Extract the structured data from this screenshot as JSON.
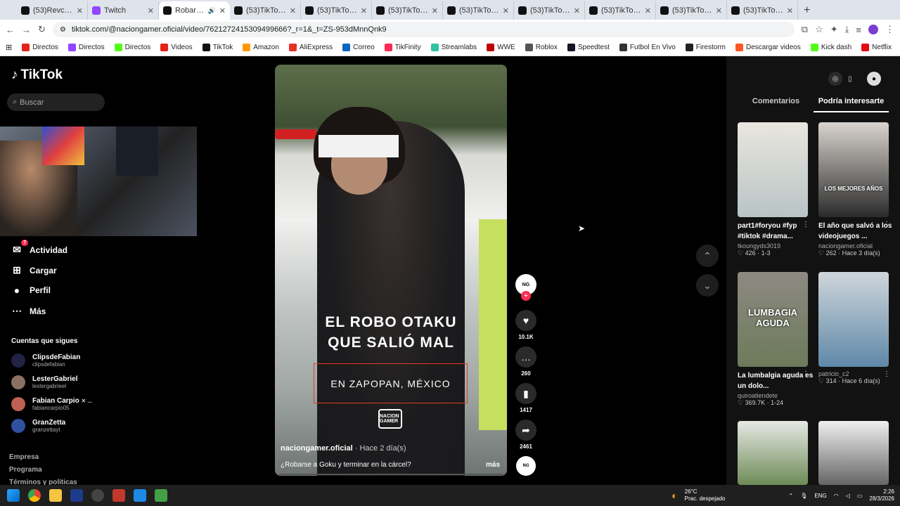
{
  "browser": {
    "tabs": [
      {
        "label": "(53)Revco (@r",
        "icon_color": "#111111",
        "active": false
      },
      {
        "label": "Twitch",
        "icon_color": "#9146ff",
        "active": false
      },
      {
        "label": "Robarse a",
        "icon_color": "#111111",
        "active": true
      },
      {
        "label": "(53)TikTok - M",
        "icon_color": "#111111",
        "active": false
      },
      {
        "label": "(53)TikTok - M",
        "icon_color": "#111111",
        "active": false
      },
      {
        "label": "(53)TikTok - M",
        "icon_color": "#111111",
        "active": false
      },
      {
        "label": "(53)TikTok - M",
        "icon_color": "#111111",
        "active": false
      },
      {
        "label": "(53)TikTok - M",
        "icon_color": "#111111",
        "active": false
      },
      {
        "label": "(53)TikTok - M",
        "icon_color": "#111111",
        "active": false
      },
      {
        "label": "(53)TikTok - M",
        "icon_color": "#111111",
        "active": false
      },
      {
        "label": "(53)TikTok - M",
        "icon_color": "#111111",
        "active": false
      }
    ],
    "url": "tiktok.com/@naciongamer.oficial/video/7621272415309499666?_r=1&_t=ZS-953dMnnQnk9",
    "bookmarks": [
      {
        "label": "Directos",
        "color": "#e62117"
      },
      {
        "label": "Directos",
        "color": "#9146ff"
      },
      {
        "label": "Directos",
        "color": "#53fc18"
      },
      {
        "label": "Videos",
        "color": "#e62117"
      },
      {
        "label": "TikTok",
        "color": "#111111"
      },
      {
        "label": "Amazon",
        "color": "#ff9900"
      },
      {
        "label": "AliExpress",
        "color": "#e43225"
      },
      {
        "label": "Correo",
        "color": "#0a66c2"
      },
      {
        "label": "TikFinity",
        "color": "#fe2c55"
      },
      {
        "label": "Streamlabs",
        "color": "#31c3a2"
      },
      {
        "label": "WWE",
        "color": "#c00000"
      },
      {
        "label": "Roblox",
        "color": "#555555"
      },
      {
        "label": "Speedtest",
        "color": "#141526"
      },
      {
        "label": "Futbol En Vivo",
        "color": "#333333"
      },
      {
        "label": "Firestorm",
        "color": "#222222"
      },
      {
        "label": "Descargar videos",
        "color": "#ff5722"
      },
      {
        "label": "Kick dash",
        "color": "#53fc18"
      },
      {
        "label": "Netflix",
        "color": "#e50914"
      }
    ]
  },
  "tiktok": {
    "logo": "TikTok",
    "search_placeholder": "Buscar",
    "nav": [
      {
        "label": "Actividad",
        "icon": "inbox-icon",
        "badge": "7"
      },
      {
        "label": "Cargar",
        "icon": "plus-square-icon"
      },
      {
        "label": "Perfil",
        "icon": "profile-icon"
      },
      {
        "label": "Más",
        "icon": "more-icon"
      }
    ],
    "following_title": "Cuentas que sigues",
    "following": [
      {
        "name": "ClipsdeFabian",
        "handle": "clipsdefabian",
        "color": "#222244"
      },
      {
        "name": "LesterGabriel",
        "handle": "lestergabrieel",
        "color": "#8a7060"
      },
      {
        "name": "Fabian Carpio",
        "handle": "fabiancarpio05",
        "color": "#c06050",
        "extra": "✕ ..."
      },
      {
        "name": "GranZetta",
        "handle": "granzettayt",
        "color": "#3050a0"
      }
    ],
    "footer": [
      "Empresa",
      "Programa",
      "Términos y políticas"
    ]
  },
  "video": {
    "headline_1": "EL ROBO OTAKU",
    "headline_2": "QUE SALIÓ MAL",
    "location": "EN ZAPOPAN, MÉXICO",
    "brand": "NACION GAMER",
    "author": "naciongamer.oficial",
    "ago": "· Hace 2 día(s)",
    "description": "¿Robarse a Goku y terminar en la cárcel?",
    "more": "más",
    "likes": "10.1K",
    "comments": "260",
    "saves": "1417",
    "shares": "2461"
  },
  "panel": {
    "tab_comments": "Comentarios",
    "tab_suggest": "Podría interesarte",
    "items": [
      {
        "caption": "part1#foryou #fyp #tiktok #drama...",
        "author": "tkoungyds3019",
        "likes": "426",
        "extra": "· 1-3",
        "bg": "linear-gradient(180deg,#e9e6df,#b9c4c5)",
        "overlay": ""
      },
      {
        "caption": "El año que salvó a los videojuegos ...",
        "author": "naciongamer.oficial",
        "likes": "262",
        "extra": "· Hace 3 día(s)",
        "bg": "linear-gradient(180deg,#d9d4cf,#2b2b2b)",
        "overlay": "LOS MEJORES AÑOS"
      },
      {
        "caption": "La lumbalgia aguda es un dolo...",
        "author": "quiroatiendete",
        "likes": "369.7K",
        "extra": "· 1-24",
        "bg": "linear-gradient(180deg,#8d8a82,#6c7a5a)",
        "overlay": "LUMBAGIA AGUDA"
      },
      {
        "caption": "",
        "author": "patricio_c2",
        "likes": "314",
        "extra": "· Hace 6 día(s)",
        "bg": "linear-gradient(180deg,#cfd6da,#5f88a8)",
        "overlay": ""
      }
    ]
  },
  "taskbar": {
    "weather_temp": "26°C",
    "weather_desc": "Prac. despejado",
    "lang": "ENG",
    "time": "2:26",
    "date": "28/3/2026"
  }
}
